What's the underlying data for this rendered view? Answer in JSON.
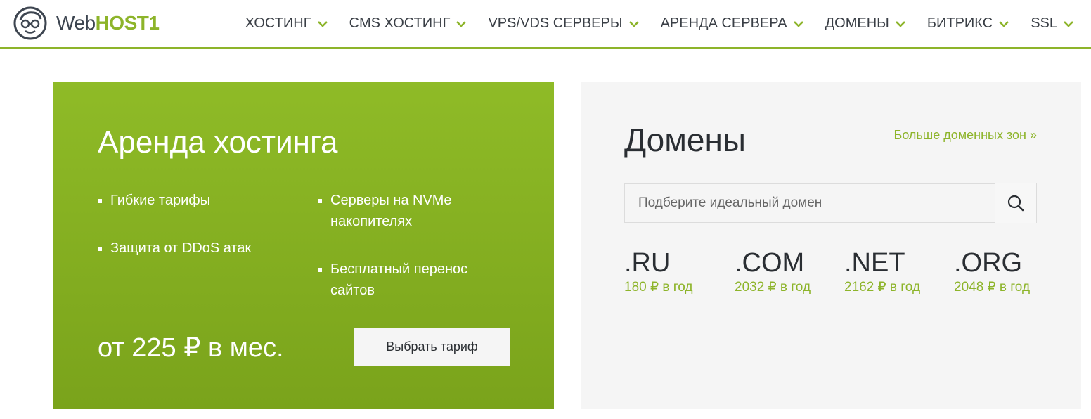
{
  "header": {
    "logo": {
      "web": "Web",
      "host": "HOST1"
    },
    "nav": [
      {
        "label": "ХОСТИНГ"
      },
      {
        "label": "CMS ХОСТИНГ"
      },
      {
        "label": "VPS/VDS СЕРВЕРЫ"
      },
      {
        "label": "АРЕНДА СЕРВЕРА"
      },
      {
        "label": "ДОМЕНЫ"
      },
      {
        "label": "БИТРИКС"
      },
      {
        "label": "SSL"
      }
    ]
  },
  "hosting": {
    "title": "Аренда хостинга",
    "features": [
      "Гибкие тарифы",
      "Серверы на NVMe накопителях",
      "Защита от DDoS атак",
      "Бесплатный перенос сайтов"
    ],
    "price": "от 225 ₽ в мес.",
    "button": "Выбрать тариф"
  },
  "domains": {
    "title": "Домены",
    "more_link": "Больше доменных зон »",
    "search_placeholder": "Подберите идеальный домен",
    "zones": [
      {
        "name": ".RU",
        "price": "180 ₽ в год"
      },
      {
        "name": ".COM",
        "price": "2032 ₽ в год"
      },
      {
        "name": ".NET",
        "price": "2162 ₽ в год"
      },
      {
        "name": ".ORG",
        "price": "2048 ₽ в год"
      }
    ]
  },
  "colors": {
    "accent": "#8db42a",
    "text": "#3a3f46",
    "panel": "#f5f5f5"
  },
  "icons": {
    "logo": "nerd-face-glasses-icon",
    "nav_arrow": "chevron-down-icon",
    "search": "search-icon"
  }
}
